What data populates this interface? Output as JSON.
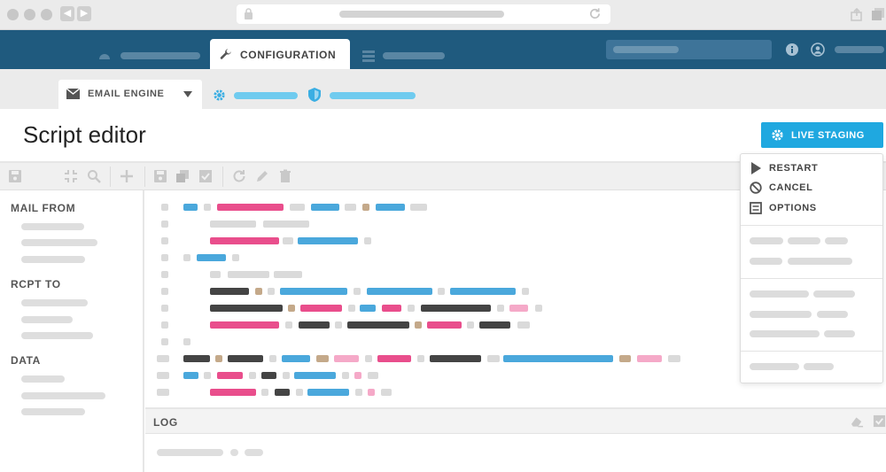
{
  "nav": {
    "active_tab": "CONFIGURATION"
  },
  "subnav": {
    "active_tab": "EMAIL ENGINE"
  },
  "page": {
    "title": "Script editor",
    "live_button": "LIVE STAGING"
  },
  "sidebar": {
    "sections": [
      "MAIL FROM",
      "RCPT TO",
      "DATA"
    ]
  },
  "log": {
    "label": "LOG"
  },
  "dropdown": {
    "items": [
      "RESTART",
      "CANCEL",
      "OPTIONS"
    ]
  },
  "colors": {
    "nav_bg": "#1f5a7e",
    "accent": "#1fa8e0",
    "token_blue": "#4aa8dc",
    "token_pink": "#e94e8c",
    "token_dark": "#444444",
    "token_gray": "#dadada",
    "token_tan": "#c4a98a",
    "token_lightpink": "#f5a9c8"
  }
}
